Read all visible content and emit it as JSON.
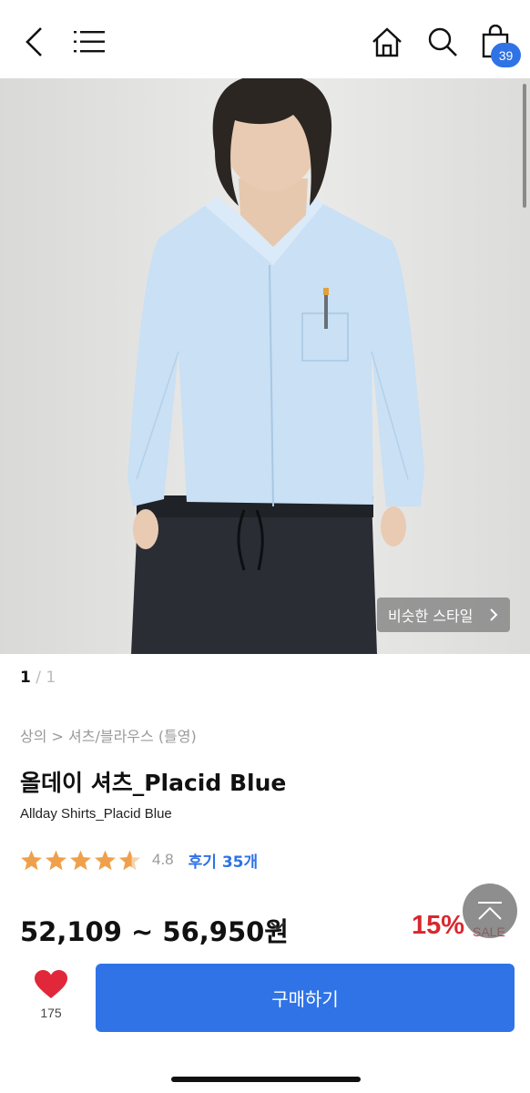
{
  "header": {
    "cart_count": "39"
  },
  "hero": {
    "similar_style_label": "비슷한 스타일"
  },
  "pager": {
    "current": "1",
    "separator_total": " / 1"
  },
  "product": {
    "category": "상의 > 셔츠/블라우스 (틀영)",
    "title": "올데이 셔츠_Placid Blue",
    "subtitle": "Allday Shirts_Placid Blue",
    "rating": "4.8",
    "rating_value": 4.8,
    "reviews": "후기 35개",
    "price": "52,109 ~ 56,950원",
    "discount": "15%",
    "sale_label": "SALE"
  },
  "bottom_bar": {
    "like_count": "175",
    "buy_label": "구매하기"
  },
  "colors": {
    "accent": "#2f73e6",
    "discount": "#d8282f",
    "star": "#f0a04b",
    "like": "#e0283a"
  }
}
